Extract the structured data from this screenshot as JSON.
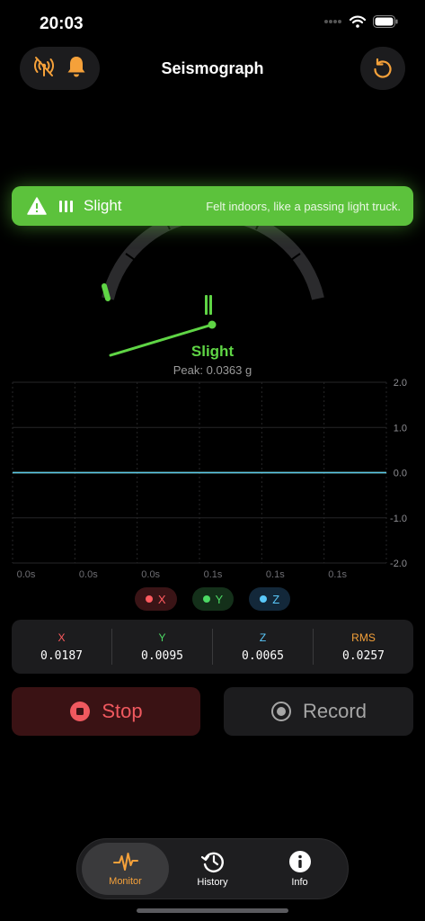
{
  "status": {
    "time": "20:03"
  },
  "nav": {
    "title": "Seismograph"
  },
  "banner": {
    "level": "Slight",
    "description": "Felt indoors, like a passing light truck."
  },
  "gauge": {
    "level_label": "Slight",
    "peak_text": "Peak: 0.0363 g"
  },
  "chart_data": {
    "type": "line",
    "x_tick_labels": [
      "0.0s",
      "0.0s",
      "0.0s",
      "0.1s",
      "0.1s",
      "0.1s"
    ],
    "y_ticks": [
      2.0,
      1.0,
      0.0,
      -1.0,
      -2.0
    ],
    "y_tick_labels": [
      "2.0",
      "1.0",
      "0.0",
      "-1.0",
      "-2.0"
    ],
    "ylim": [
      -2.0,
      2.0
    ],
    "grid": true,
    "series": [
      {
        "name": "X",
        "color": "#ff5a5f",
        "values": [
          0,
          0,
          0,
          0,
          0,
          0
        ]
      },
      {
        "name": "Y",
        "color": "#4cd964",
        "values": [
          0,
          0,
          0,
          0,
          0,
          0
        ]
      },
      {
        "name": "Z",
        "color": "#5ac8fa",
        "values": [
          0,
          0,
          0,
          0,
          0,
          0
        ]
      }
    ]
  },
  "legend": [
    {
      "label": "X",
      "color": "#ff5a5f",
      "bg": "#3a1416"
    },
    {
      "label": "Y",
      "color": "#4cd964",
      "bg": "#14301a"
    },
    {
      "label": "Z",
      "color": "#5ac8fa",
      "bg": "#13283a"
    }
  ],
  "readings": [
    {
      "label": "X",
      "value": "0.0187",
      "color": "#ff5a5f"
    },
    {
      "label": "Y",
      "value": "0.0095",
      "color": "#4cd964"
    },
    {
      "label": "Z",
      "value": "0.0065",
      "color": "#5ac8fa"
    },
    {
      "label": "RMS",
      "value": "0.0257",
      "color": "#f5a13a"
    }
  ],
  "actions": {
    "stop_label": "Stop",
    "record_label": "Record"
  },
  "tabs": [
    {
      "label": "Monitor",
      "icon": "waveform-icon",
      "active": true
    },
    {
      "label": "History",
      "icon": "history-clock-icon",
      "active": false
    },
    {
      "label": "Info",
      "icon": "info-icon",
      "active": false
    }
  ],
  "colors": {
    "accent": "#f5a13a",
    "intensity_green": "#5cc23c",
    "stop_red": "#f0595f"
  }
}
